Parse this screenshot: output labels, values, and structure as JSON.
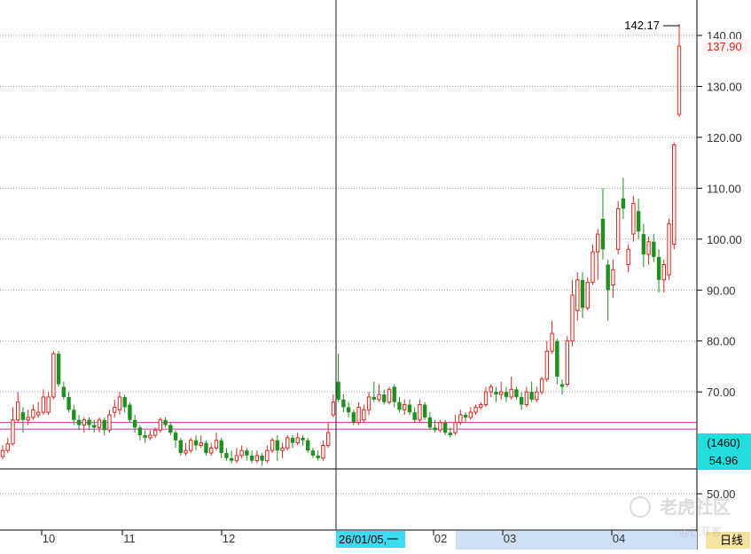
{
  "chart_data": {
    "type": "candlestick",
    "timeframe_label": "日线",
    "y_axis": {
      "ticks": [
        "140.00",
        "130.00",
        "120.00",
        "110.00",
        "100.00",
        "90.00",
        "80.00",
        "70.00",
        "50.00"
      ],
      "ylim": [
        42,
        146
      ]
    },
    "x_axis": {
      "month_labels": [
        "10",
        "11",
        "12",
        "02",
        "03",
        "04"
      ],
      "crosshair_date_label": "26/01/05,一"
    },
    "annotations": {
      "high_label": "142.17",
      "last_price_label": "137.90",
      "level_box_top": "(1460)",
      "level_box_bottom": "54.96"
    },
    "horizontal_lines": [
      64.0,
      62.7
    ],
    "crosshair": {
      "date": "26/01/05"
    },
    "colors": {
      "up": "#d9281f",
      "down": "#1f8f1f",
      "level_line": "#cc33aa",
      "crosshair_label_bg": "#3cdcf0",
      "range_highlight": "#cfe0f5",
      "last_price": "#d9281f"
    },
    "watermark": "老虎社区",
    "watermark_handle": "@巴菲客",
    "candles": [
      {
        "o": 57.3,
        "c": 58.5,
        "h": 59.5,
        "l": 56.8
      },
      {
        "o": 58.5,
        "c": 59.8,
        "h": 61.0,
        "l": 58.0
      },
      {
        "o": 59.8,
        "c": 64.5,
        "h": 67.0,
        "l": 59.5
      },
      {
        "o": 64.5,
        "c": 68.0,
        "h": 70.0,
        "l": 64.0
      },
      {
        "o": 66.0,
        "c": 64.5,
        "h": 67.0,
        "l": 62.0
      },
      {
        "o": 64.5,
        "c": 65.0,
        "h": 66.5,
        "l": 63.5
      },
      {
        "o": 65.0,
        "c": 66.5,
        "h": 67.5,
        "l": 64.5
      },
      {
        "o": 65.5,
        "c": 66.0,
        "h": 68.0,
        "l": 65.0
      },
      {
        "o": 66.0,
        "c": 69.0,
        "h": 70.5,
        "l": 65.5
      },
      {
        "o": 66.0,
        "c": 69.0,
        "h": 70.0,
        "l": 65.5
      },
      {
        "o": 69.0,
        "c": 77.5,
        "h": 78.0,
        "l": 68.5
      },
      {
        "o": 77.5,
        "c": 71.5,
        "h": 78.0,
        "l": 71.0
      },
      {
        "o": 71.0,
        "c": 69.0,
        "h": 72.0,
        "l": 68.5
      },
      {
        "o": 69.0,
        "c": 66.5,
        "h": 70.0,
        "l": 66.0
      },
      {
        "o": 66.5,
        "c": 64.5,
        "h": 67.5,
        "l": 63.5
      },
      {
        "o": 64.5,
        "c": 63.5,
        "h": 65.5,
        "l": 62.5
      },
      {
        "o": 63.5,
        "c": 64.5,
        "h": 65.0,
        "l": 62.0
      },
      {
        "o": 64.5,
        "c": 63.5,
        "h": 65.0,
        "l": 62.5
      },
      {
        "o": 63.5,
        "c": 63.0,
        "h": 64.5,
        "l": 62.0
      },
      {
        "o": 63.0,
        "c": 64.5,
        "h": 65.0,
        "l": 62.0
      },
      {
        "o": 64.5,
        "c": 62.5,
        "h": 65.0,
        "l": 61.5
      },
      {
        "o": 62.5,
        "c": 65.5,
        "h": 66.5,
        "l": 62.0
      },
      {
        "o": 66.0,
        "c": 67.0,
        "h": 68.5,
        "l": 65.0
      },
      {
        "o": 66.5,
        "c": 69.0,
        "h": 70.0,
        "l": 65.5
      },
      {
        "o": 69.0,
        "c": 67.0,
        "h": 69.5,
        "l": 66.0
      },
      {
        "o": 67.5,
        "c": 64.5,
        "h": 68.0,
        "l": 64.0
      },
      {
        "o": 64.5,
        "c": 63.0,
        "h": 65.5,
        "l": 62.0
      },
      {
        "o": 63.0,
        "c": 61.5,
        "h": 63.5,
        "l": 60.5
      },
      {
        "o": 61.5,
        "c": 61.0,
        "h": 62.5,
        "l": 60.0
      },
      {
        "o": 61.0,
        "c": 61.5,
        "h": 62.5,
        "l": 60.5
      },
      {
        "o": 61.5,
        "c": 62.5,
        "h": 63.0,
        "l": 61.0
      },
      {
        "o": 62.5,
        "c": 64.5,
        "h": 65.0,
        "l": 62.0
      },
      {
        "o": 64.5,
        "c": 63.5,
        "h": 65.0,
        "l": 63.0
      },
      {
        "o": 63.5,
        "c": 62.0,
        "h": 64.0,
        "l": 61.5
      },
      {
        "o": 62.0,
        "c": 60.5,
        "h": 62.5,
        "l": 59.0
      },
      {
        "o": 60.5,
        "c": 58.0,
        "h": 61.0,
        "l": 57.5
      },
      {
        "o": 58.0,
        "c": 58.5,
        "h": 60.0,
        "l": 57.5
      },
      {
        "o": 58.5,
        "c": 60.5,
        "h": 61.0,
        "l": 58.0
      },
      {
        "o": 60.5,
        "c": 59.5,
        "h": 61.5,
        "l": 58.5
      },
      {
        "o": 59.5,
        "c": 60.0,
        "h": 61.5,
        "l": 59.0
      },
      {
        "o": 60.0,
        "c": 58.0,
        "h": 60.5,
        "l": 57.5
      },
      {
        "o": 58.0,
        "c": 59.0,
        "h": 60.0,
        "l": 57.5
      },
      {
        "o": 59.0,
        "c": 60.5,
        "h": 62.0,
        "l": 58.5
      },
      {
        "o": 60.5,
        "c": 58.0,
        "h": 61.0,
        "l": 57.0
      },
      {
        "o": 58.0,
        "c": 57.0,
        "h": 59.0,
        "l": 56.5
      },
      {
        "o": 57.0,
        "c": 56.5,
        "h": 58.5,
        "l": 56.0
      },
      {
        "o": 56.5,
        "c": 57.5,
        "h": 59.0,
        "l": 56.0
      },
      {
        "o": 57.5,
        "c": 58.5,
        "h": 59.5,
        "l": 57.0
      },
      {
        "o": 58.5,
        "c": 57.5,
        "h": 59.0,
        "l": 56.5
      },
      {
        "o": 57.5,
        "c": 56.5,
        "h": 58.5,
        "l": 56.0
      },
      {
        "o": 56.5,
        "c": 57.5,
        "h": 58.5,
        "l": 56.0
      },
      {
        "o": 57.5,
        "c": 56.5,
        "h": 58.0,
        "l": 55.5
      },
      {
        "o": 56.5,
        "c": 58.5,
        "h": 59.5,
        "l": 56.0
      },
      {
        "o": 58.5,
        "c": 60.5,
        "h": 61.0,
        "l": 58.0
      },
      {
        "o": 60.5,
        "c": 58.5,
        "h": 61.5,
        "l": 56.5
      },
      {
        "o": 58.5,
        "c": 59.0,
        "h": 60.0,
        "l": 57.0
      },
      {
        "o": 59.0,
        "c": 61.0,
        "h": 61.5,
        "l": 58.5
      },
      {
        "o": 61.0,
        "c": 60.0,
        "h": 61.5,
        "l": 59.0
      },
      {
        "o": 60.0,
        "c": 61.0,
        "h": 62.0,
        "l": 59.5
      },
      {
        "o": 61.0,
        "c": 60.5,
        "h": 61.5,
        "l": 59.5
      },
      {
        "o": 60.5,
        "c": 58.5,
        "h": 61.0,
        "l": 58.0
      },
      {
        "o": 58.5,
        "c": 57.5,
        "h": 59.0,
        "l": 57.0
      },
      {
        "o": 57.5,
        "c": 57.0,
        "h": 58.5,
        "l": 56.5
      },
      {
        "o": 57.0,
        "c": 59.5,
        "h": 60.5,
        "l": 56.5
      },
      {
        "o": 59.5,
        "c": 62.0,
        "h": 64.0,
        "l": 59.0
      },
      {
        "o": 65.5,
        "c": 68.0,
        "h": 69.5,
        "l": 65.0
      },
      {
        "o": 72.0,
        "c": 68.5,
        "h": 77.5,
        "l": 68.0
      },
      {
        "o": 68.5,
        "c": 67.0,
        "h": 69.5,
        "l": 66.0
      },
      {
        "o": 67.0,
        "c": 66.0,
        "h": 68.0,
        "l": 65.0
      },
      {
        "o": 66.0,
        "c": 64.0,
        "h": 66.5,
        "l": 63.5
      },
      {
        "o": 64.0,
        "c": 67.0,
        "h": 68.0,
        "l": 63.5
      },
      {
        "o": 64.5,
        "c": 66.5,
        "h": 67.5,
        "l": 64.0
      },
      {
        "o": 66.5,
        "c": 69.0,
        "h": 70.0,
        "l": 65.5
      },
      {
        "o": 69.0,
        "c": 68.5,
        "h": 72.0,
        "l": 68.0
      },
      {
        "o": 68.5,
        "c": 69.5,
        "h": 71.5,
        "l": 68.0
      },
      {
        "o": 69.5,
        "c": 68.0,
        "h": 70.5,
        "l": 67.5
      },
      {
        "o": 68.0,
        "c": 70.5,
        "h": 71.0,
        "l": 67.5
      },
      {
        "o": 71.0,
        "c": 68.0,
        "h": 71.5,
        "l": 67.0
      },
      {
        "o": 68.0,
        "c": 66.5,
        "h": 69.0,
        "l": 66.0
      },
      {
        "o": 66.5,
        "c": 67.5,
        "h": 68.5,
        "l": 65.5
      },
      {
        "o": 67.5,
        "c": 66.0,
        "h": 68.5,
        "l": 65.5
      },
      {
        "o": 66.0,
        "c": 64.5,
        "h": 67.0,
        "l": 64.0
      },
      {
        "o": 64.5,
        "c": 67.5,
        "h": 68.5,
        "l": 64.0
      },
      {
        "o": 67.5,
        "c": 65.0,
        "h": 68.0,
        "l": 64.5
      },
      {
        "o": 65.0,
        "c": 63.0,
        "h": 66.0,
        "l": 62.5
      },
      {
        "o": 63.0,
        "c": 62.5,
        "h": 64.5,
        "l": 62.0
      },
      {
        "o": 62.5,
        "c": 64.0,
        "h": 64.5,
        "l": 62.0
      },
      {
        "o": 64.0,
        "c": 62.0,
        "h": 64.5,
        "l": 61.5
      },
      {
        "o": 62.0,
        "c": 61.5,
        "h": 63.0,
        "l": 61.0
      },
      {
        "o": 62.0,
        "c": 64.0,
        "h": 65.5,
        "l": 61.5
      },
      {
        "o": 64.0,
        "c": 65.5,
        "h": 66.5,
        "l": 63.5
      },
      {
        "o": 65.5,
        "c": 65.0,
        "h": 66.0,
        "l": 64.0
      },
      {
        "o": 65.0,
        "c": 66.0,
        "h": 67.0,
        "l": 64.5
      },
      {
        "o": 66.0,
        "c": 67.0,
        "h": 67.5,
        "l": 65.5
      },
      {
        "o": 67.0,
        "c": 67.5,
        "h": 68.0,
        "l": 66.5
      },
      {
        "o": 67.5,
        "c": 70.0,
        "h": 71.0,
        "l": 67.0
      },
      {
        "o": 70.0,
        "c": 71.0,
        "h": 71.5,
        "l": 69.0
      },
      {
        "o": 70.0,
        "c": 69.5,
        "h": 71.0,
        "l": 68.0
      },
      {
        "o": 69.5,
        "c": 70.0,
        "h": 72.0,
        "l": 68.5
      },
      {
        "o": 70.0,
        "c": 69.0,
        "h": 71.0,
        "l": 68.0
      },
      {
        "o": 69.0,
        "c": 70.5,
        "h": 73.0,
        "l": 68.5
      },
      {
        "o": 70.5,
        "c": 69.0,
        "h": 71.0,
        "l": 68.5
      },
      {
        "o": 69.0,
        "c": 67.5,
        "h": 70.0,
        "l": 66.5
      },
      {
        "o": 67.5,
        "c": 70.0,
        "h": 71.0,
        "l": 67.0
      },
      {
        "o": 70.0,
        "c": 68.5,
        "h": 72.0,
        "l": 68.0
      },
      {
        "o": 68.5,
        "c": 70.0,
        "h": 71.0,
        "l": 68.0
      },
      {
        "o": 70.0,
        "c": 72.5,
        "h": 73.0,
        "l": 69.5
      },
      {
        "o": 72.5,
        "c": 78.0,
        "h": 80.0,
        "l": 72.0
      },
      {
        "o": 78.0,
        "c": 81.5,
        "h": 84.0,
        "l": 77.5
      },
      {
        "o": 80.0,
        "c": 73.0,
        "h": 80.5,
        "l": 71.5
      },
      {
        "o": 71.5,
        "c": 71.0,
        "h": 72.5,
        "l": 69.5
      },
      {
        "o": 71.5,
        "c": 80.0,
        "h": 81.0,
        "l": 71.0
      },
      {
        "o": 80.0,
        "c": 89.0,
        "h": 92.0,
        "l": 79.0
      },
      {
        "o": 86.0,
        "c": 92.0,
        "h": 93.5,
        "l": 84.0
      },
      {
        "o": 92.0,
        "c": 86.5,
        "h": 93.5,
        "l": 84.5
      },
      {
        "o": 86.5,
        "c": 91.5,
        "h": 92.5,
        "l": 86.0
      },
      {
        "o": 91.5,
        "c": 97.5,
        "h": 99.0,
        "l": 91.0
      },
      {
        "o": 97.5,
        "c": 101.0,
        "h": 102.0,
        "l": 92.0
      },
      {
        "o": 104.0,
        "c": 98.0,
        "h": 110.0,
        "l": 96.0
      },
      {
        "o": 95.0,
        "c": 90.0,
        "h": 96.0,
        "l": 84.0
      },
      {
        "o": 91.0,
        "c": 94.0,
        "h": 96.0,
        "l": 88.5
      },
      {
        "o": 98.0,
        "c": 106.0,
        "h": 107.5,
        "l": 97.0
      },
      {
        "o": 108.0,
        "c": 106.0,
        "h": 112.0,
        "l": 104.0
      },
      {
        "o": 95.0,
        "c": 98.0,
        "h": 99.0,
        "l": 93.5
      },
      {
        "o": 101.0,
        "c": 107.0,
        "h": 108.5,
        "l": 99.5
      },
      {
        "o": 105.5,
        "c": 101.5,
        "h": 108.0,
        "l": 100.0
      },
      {
        "o": 101.0,
        "c": 97.0,
        "h": 103.0,
        "l": 94.5
      },
      {
        "o": 97.0,
        "c": 99.5,
        "h": 100.5,
        "l": 95.0
      },
      {
        "o": 99.5,
        "c": 96.5,
        "h": 101.0,
        "l": 95.5
      },
      {
        "o": 96.5,
        "c": 92.0,
        "h": 98.0,
        "l": 89.5
      },
      {
        "o": 92.0,
        "c": 95.0,
        "h": 96.0,
        "l": 89.5
      },
      {
        "o": 93.0,
        "c": 103.0,
        "h": 104.0,
        "l": 92.0
      },
      {
        "o": 99.0,
        "c": 118.5,
        "h": 119.0,
        "l": 98.0
      },
      {
        "o": 124.5,
        "c": 137.9,
        "h": 142.17,
        "l": 124.0
      }
    ]
  }
}
